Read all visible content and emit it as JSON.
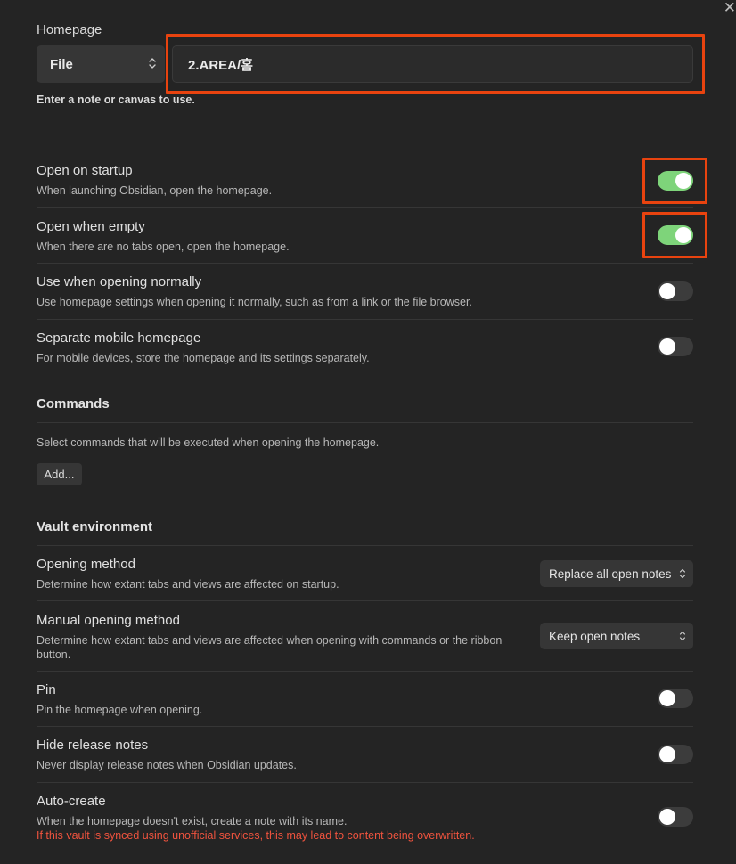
{
  "close_glyph": "✕",
  "homepage": {
    "title": "Homepage",
    "type_select": "File",
    "value": "2.AREA/홈",
    "help": "Enter a note or canvas to use."
  },
  "settings": [
    {
      "name": "Open on startup",
      "desc": "When launching Obsidian, open the homepage.",
      "on": true
    },
    {
      "name": "Open when empty",
      "desc": "When there are no tabs open, open the homepage.",
      "on": true
    },
    {
      "name": "Use when opening normally",
      "desc": "Use homepage settings when opening it normally, such as from a link or the file browser.",
      "on": false
    },
    {
      "name": "Separate mobile homepage",
      "desc": "For mobile devices, store the homepage and its settings separately.",
      "on": false
    }
  ],
  "commands": {
    "title": "Commands",
    "desc": "Select commands that will be executed when opening the homepage.",
    "add_label": "Add..."
  },
  "vault": {
    "title": "Vault environment",
    "opening_method": {
      "name": "Opening method",
      "desc": "Determine how extant tabs and views are affected on startup.",
      "value": "Replace all open notes"
    },
    "manual_opening_method": {
      "name": "Manual opening method",
      "desc": "Determine how extant tabs and views are affected when opening with commands or the ribbon button.",
      "value": "Keep open notes"
    },
    "pin": {
      "name": "Pin",
      "desc": "Pin the homepage when opening.",
      "on": false
    },
    "hide_release_notes": {
      "name": "Hide release notes",
      "desc": "Never display release notes when Obsidian updates.",
      "on": false
    },
    "auto_create": {
      "name": "Auto-create",
      "desc": "When the homepage doesn't exist, create a note with its name.",
      "warning": "If this vault is synced using unofficial services, this may lead to content being overwritten.",
      "on": false
    }
  },
  "colors": {
    "background": "#242424",
    "toggle_on": "#7ed47a",
    "highlight": "#e8430f",
    "warning": "#f0533e"
  }
}
